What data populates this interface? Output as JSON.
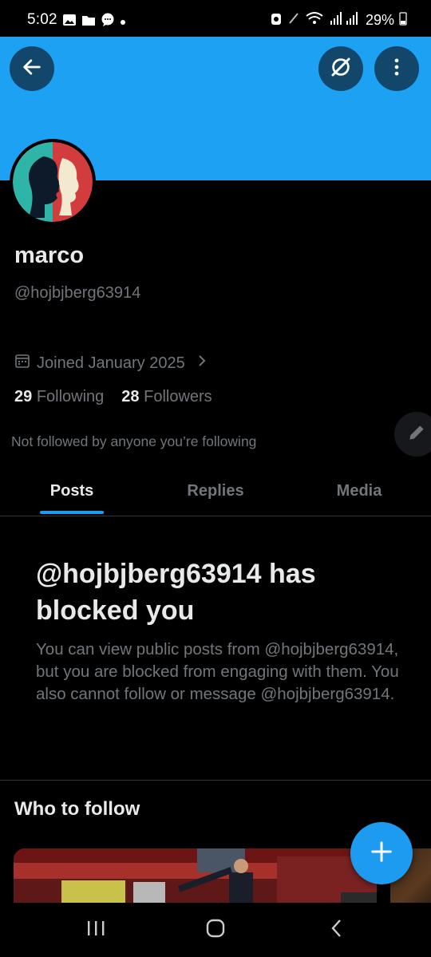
{
  "status_bar": {
    "time": "5:02",
    "battery": "29%"
  },
  "profile": {
    "display_name": "marco",
    "handle": "@hojbjberg63914",
    "joined": "Joined January 2025",
    "following_count": "29",
    "following_label": "Following",
    "followers_count": "28",
    "followers_label": "Followers",
    "not_followed_text": "Not followed by anyone you’re following"
  },
  "tabs": [
    {
      "label": "Posts",
      "active": true
    },
    {
      "label": "Replies",
      "active": false
    },
    {
      "label": "Media",
      "active": false
    }
  ],
  "blocked": {
    "title": "@hojbjberg63914 has blocked you",
    "body": "You can view public posts from @hojbjberg63914, but you are blocked from engaging with them. You also cannot follow or message @hojbjberg63914."
  },
  "who_to_follow": {
    "heading": "Who to follow"
  },
  "icons": {
    "back": "arrow-left-icon",
    "grok": "grok-icon",
    "more": "more-vertical-icon",
    "calendar": "calendar-icon",
    "chevron": "chevron-right-icon",
    "edit": "pencil-icon",
    "compose": "plus-icon",
    "nav_recents": "recents-icon",
    "nav_home": "home-icon",
    "nav_back": "nav-back-icon"
  },
  "colors": {
    "banner": "#1da1f2",
    "accent": "#1d9bf0",
    "background": "#000000",
    "text_primary": "#e7e9ea",
    "text_secondary": "#71767b"
  }
}
